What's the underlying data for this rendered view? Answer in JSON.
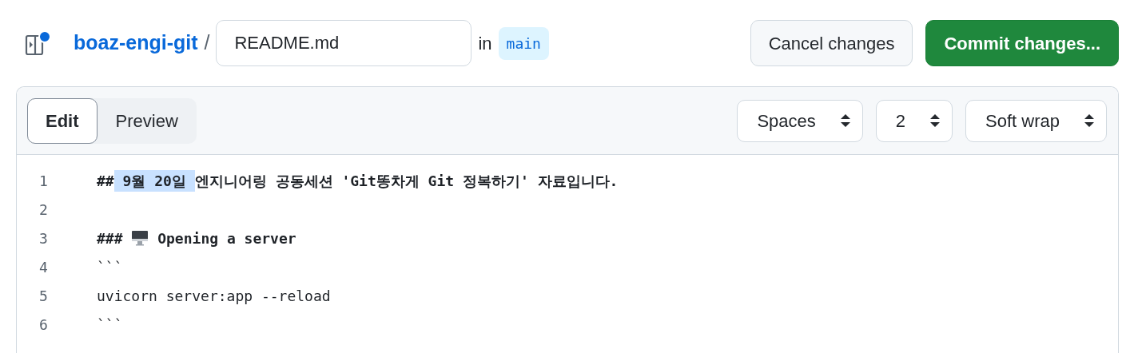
{
  "header": {
    "repo": "boaz-engi-git",
    "separator": "/",
    "filename": "README.md",
    "in_label": "in",
    "branch": "main",
    "notification": true
  },
  "actions": [
    {
      "label": "Cancel changes",
      "kind": "secondary"
    },
    {
      "label": "Commit changes...",
      "kind": "primary"
    }
  ],
  "tabs": [
    {
      "label": "Edit",
      "selected": true
    },
    {
      "label": "Preview",
      "selected": false
    }
  ],
  "selects": [
    {
      "value": "Spaces"
    },
    {
      "value": "2"
    },
    {
      "value": "Soft wrap"
    }
  ],
  "lines": [
    {
      "number": "1",
      "bold": true,
      "parts": [
        {
          "kind": "text",
          "text": "##",
          "selected": false
        },
        {
          "kind": "text",
          "text": " 9월 20일 ",
          "selected": true
        },
        {
          "kind": "text",
          "text": "엔지니어링 공동세션 'Git똥차게 Git 정복하기' 자료입니다.",
          "selected": false
        }
      ]
    },
    {
      "number": "2"
    },
    {
      "number": "3",
      "bold": true,
      "parts": [
        {
          "kind": "text",
          "text": "### ",
          "selected": false
        },
        {
          "kind": "icon"
        },
        {
          "kind": "text",
          "text": " Opening a server",
          "selected": false
        }
      ]
    },
    {
      "number": "4",
      "bold": false,
      "parts": [
        {
          "kind": "text",
          "text": "```",
          "selected": false
        }
      ]
    },
    {
      "number": "5",
      "bold": false,
      "parts": [
        {
          "kind": "text",
          "text": "uvicorn server:app --reload",
          "selected": false
        }
      ]
    },
    {
      "number": "6",
      "bold": false,
      "parts": [
        {
          "kind": "text",
          "text": "```",
          "selected": false
        }
      ]
    }
  ]
}
